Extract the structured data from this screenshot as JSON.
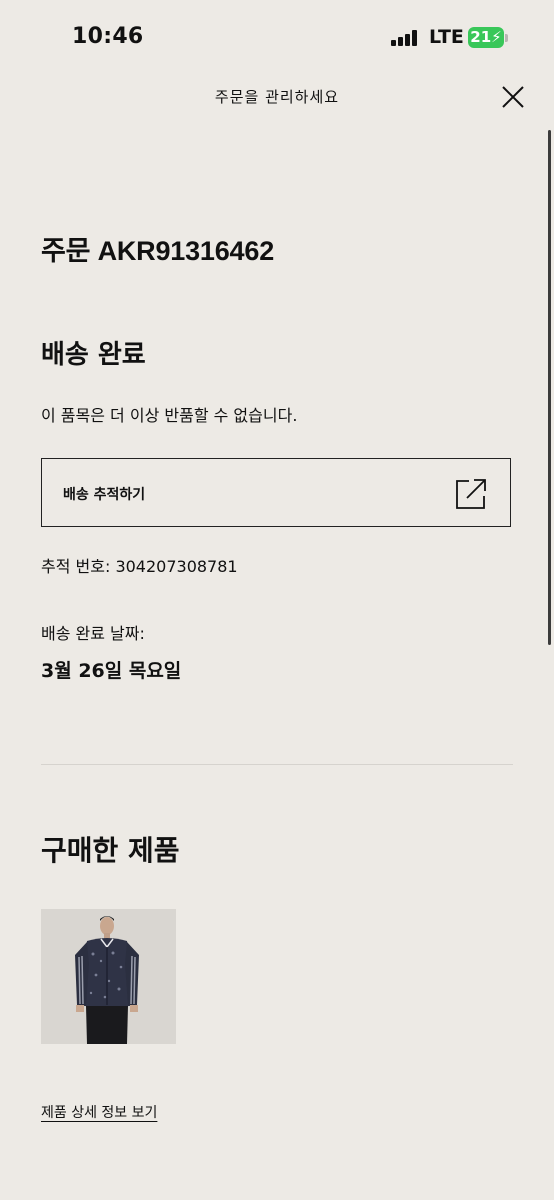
{
  "status_bar": {
    "time": "10:46",
    "network": "LTE",
    "battery": "21"
  },
  "header": {
    "title": "주문을 관리하세요"
  },
  "order": {
    "number_label": "주문 AKR91316462",
    "status": "배송 완료",
    "return_note": "이 품목은 더 이상 반품할 수 없습니다.",
    "track_button_label": "배송 추적하기",
    "tracking_number": "추적 번호: 304207308781",
    "delivery_date_label": "배송 완료 날짜:",
    "delivery_date": "3월 26일 목요일"
  },
  "products": {
    "heading": "구매한 제품",
    "detail_link": "제품 상세 정보 보기"
  },
  "colors": {
    "background": "#edeae5",
    "text": "#111111",
    "battery": "#39c759"
  }
}
